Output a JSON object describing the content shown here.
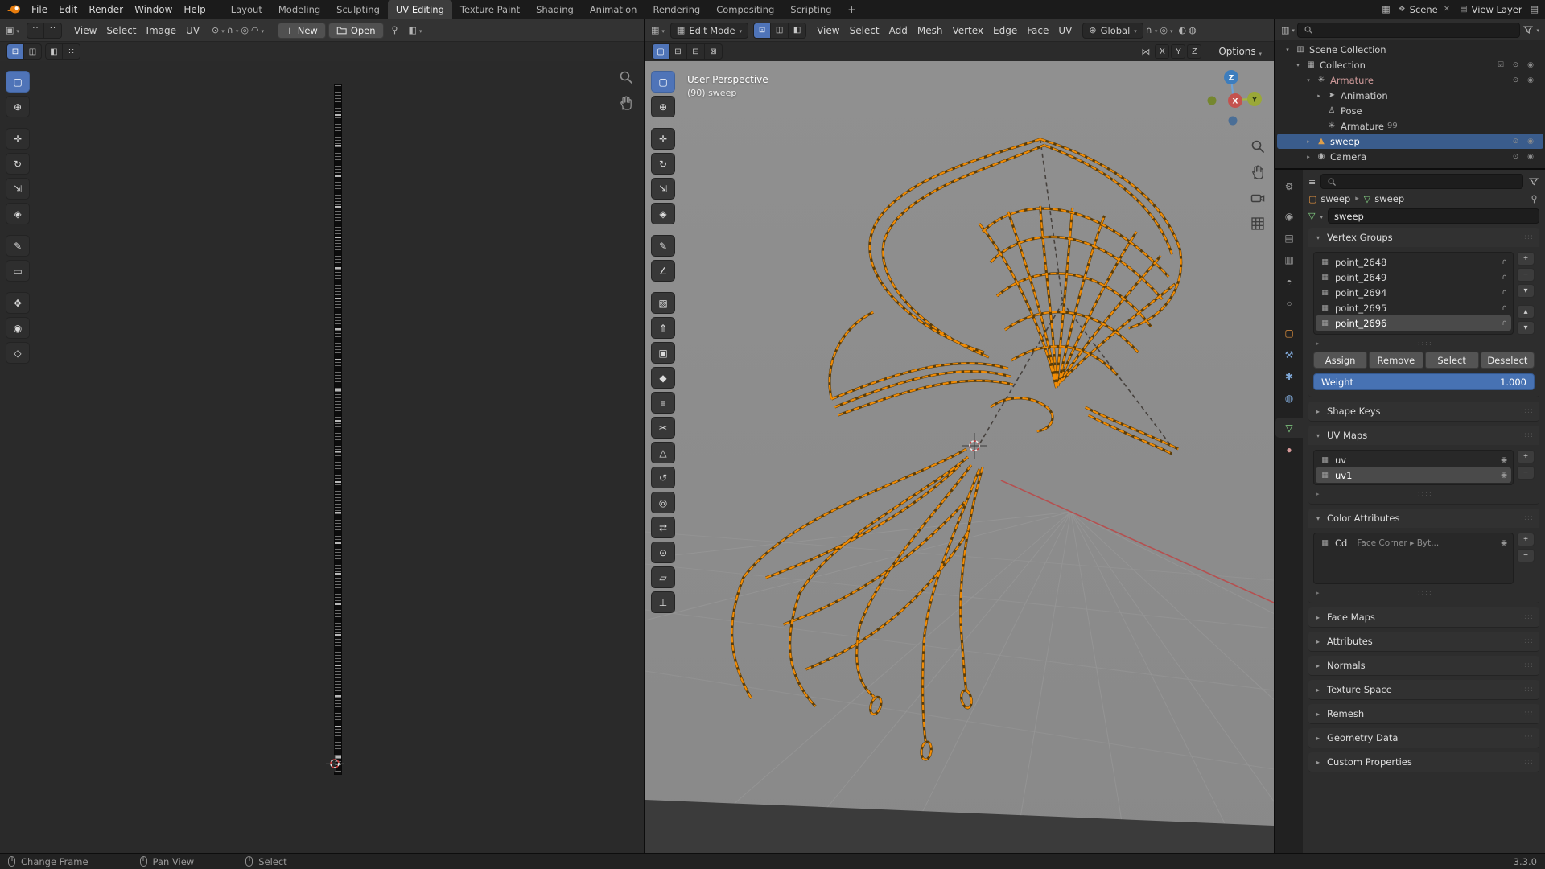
{
  "topbar": {
    "app_menus": [
      "File",
      "Edit",
      "Render",
      "Window",
      "Help"
    ],
    "workspaces": [
      {
        "name": "workspace-tab-layout",
        "label": "Layout"
      },
      {
        "name": "workspace-tab-modeling",
        "label": "Modeling"
      },
      {
        "name": "workspace-tab-sculpting",
        "label": "Sculpting"
      },
      {
        "name": "workspace-tab-uv-editing",
        "label": "UV Editing",
        "active": true
      },
      {
        "name": "workspace-tab-texture-paint",
        "label": "Texture Paint"
      },
      {
        "name": "workspace-tab-shading",
        "label": "Shading"
      },
      {
        "name": "workspace-tab-animation",
        "label": "Animation"
      },
      {
        "name": "workspace-tab-rendering",
        "label": "Rendering"
      },
      {
        "name": "workspace-tab-compositing",
        "label": "Compositing"
      },
      {
        "name": "workspace-tab-scripting",
        "label": "Scripting"
      }
    ],
    "add_workspace": "+",
    "scene_label": "Scene",
    "view_layer_label": "View Layer"
  },
  "icons": {
    "chevron": "▾",
    "expander_closed": "▸",
    "editor_image": "▣",
    "editor_3d": "▦",
    "editor_outliner": "▥",
    "editor_props": "≣",
    "grid_toggle": "∷",
    "pivot": "⊙",
    "magnet": "∩",
    "proportional": "◎",
    "falloff": "◠",
    "vertex_mode": "⊡",
    "edge_mode": "◫",
    "face_mode": "◧",
    "orientation": "⊕",
    "mirror": "⋈",
    "overlays": "◐",
    "shading": "◍",
    "plus": "+",
    "minus": "−",
    "up": "▴",
    "down": "▾",
    "scene": "❖",
    "view_layer": "▤",
    "close": "✕",
    "checkbox": "☑",
    "object": "▢",
    "mesh_data": "▽",
    "camera_toggle": "◉",
    "lock": "∩",
    "vgroup": "▦",
    "uvmap": "▦",
    "dots": "::::",
    "list_expand": "▸",
    "display_channel": "◧",
    "window_a": "▤",
    "window_b": "▦"
  },
  "uv_editor": {
    "menus": [
      "View",
      "Select",
      "Image",
      "UV"
    ],
    "new_label": "New",
    "open_label": "Open",
    "tools": [
      {
        "name": "tool-select-box",
        "icon": "▢",
        "active": true
      },
      {
        "name": "tool-cursor",
        "icon": "⊕"
      },
      {
        "name": "tool-move",
        "icon": "✛",
        "gap": true
      },
      {
        "name": "tool-rotate",
        "icon": "↻"
      },
      {
        "name": "tool-scale",
        "icon": "⇲"
      },
      {
        "name": "tool-transform",
        "icon": "◈"
      },
      {
        "name": "tool-annotate",
        "icon": "✎",
        "gap": true
      },
      {
        "name": "tool-rip-region",
        "icon": "▭"
      },
      {
        "name": "tool-grab",
        "icon": "✥",
        "gap": true
      },
      {
        "name": "tool-relax",
        "icon": "◉"
      },
      {
        "name": "tool-pinch",
        "icon": "◇"
      }
    ]
  },
  "viewport": {
    "mode_label": "Edit Mode",
    "menus": [
      "View",
      "Select",
      "Add",
      "Mesh",
      "Vertex",
      "Edge",
      "Face",
      "UV"
    ],
    "orientation_label": "Global",
    "options_label": "Options",
    "mirror_axes": [
      "X",
      "Y",
      "Z"
    ],
    "overlay": {
      "line1": "User Perspective",
      "line2": "(90) sweep"
    },
    "gizmo": {
      "x": "X",
      "y": "Y",
      "z": "Z"
    },
    "tools": [
      {
        "name": "tool-select-box",
        "icon": "▢",
        "active": true
      },
      {
        "name": "tool-cursor",
        "icon": "⊕"
      },
      {
        "name": "tool-move",
        "icon": "✛",
        "gap": true
      },
      {
        "name": "tool-rotate",
        "icon": "↻"
      },
      {
        "name": "tool-scale",
        "icon": "⇲"
      },
      {
        "name": "tool-transform",
        "icon": "◈"
      },
      {
        "name": "tool-annotate",
        "icon": "✎",
        "gap": true
      },
      {
        "name": "tool-measure",
        "icon": "∠"
      },
      {
        "name": "tool-add-cube",
        "icon": "▧",
        "gap": true
      },
      {
        "name": "tool-extrude",
        "icon": "⇑"
      },
      {
        "name": "tool-inset",
        "icon": "▣"
      },
      {
        "name": "tool-bevel",
        "icon": "◆"
      },
      {
        "name": "tool-loop-cut",
        "icon": "≡"
      },
      {
        "name": "tool-knife",
        "icon": "✂"
      },
      {
        "name": "tool-poly-build",
        "icon": "△"
      },
      {
        "name": "tool-spin",
        "icon": "↺"
      },
      {
        "name": "tool-smooth",
        "icon": "◎"
      },
      {
        "name": "tool-edge-slide",
        "icon": "⇄"
      },
      {
        "name": "tool-shrink-fatten",
        "icon": "⊙"
      },
      {
        "name": "tool-shear",
        "icon": "▱"
      },
      {
        "name": "tool-rip-region",
        "icon": "⊥"
      }
    ]
  },
  "outliner": {
    "rows": [
      {
        "name": "outliner-row-scene-collection",
        "label": "Scene Collection",
        "depth": 0,
        "expander": "▾",
        "icon": "▥",
        "right_icons": ""
      },
      {
        "name": "outliner-row-collection",
        "label": "Collection",
        "depth": 1,
        "expander": "▾",
        "icon": "▦",
        "right_icons": "☑ ⊙ ◉"
      },
      {
        "name": "outliner-row-armature",
        "label": "Armature",
        "depth": 2,
        "expander": "▾",
        "icon": "✳",
        "cls": "pink",
        "right_icons": "⊙ ◉"
      },
      {
        "name": "outliner-row-animation",
        "label": "Animation",
        "depth": 3,
        "expander": "▸",
        "icon": "➤",
        "right_icons": ""
      },
      {
        "name": "outliner-row-pose",
        "label": "Pose",
        "depth": 3,
        "expander": "",
        "icon": "♙",
        "right_icons": ""
      },
      {
        "name": "outliner-row-armature-data",
        "label": "Armature",
        "depth": 3,
        "expander": "",
        "icon": "✳",
        "badge": "99",
        "right_icons": ""
      },
      {
        "name": "outliner-row-sweep",
        "label": "sweep",
        "depth": 2,
        "expander": "▸",
        "icon": "▲",
        "cls": "meshobj",
        "selected": true,
        "right_icons": "⊙ ◉"
      },
      {
        "name": "outliner-row-camera",
        "label": "Camera",
        "depth": 2,
        "expander": "▸",
        "icon": "◉",
        "right_icons": "⊙ ◉"
      }
    ]
  },
  "properties": {
    "tabs": [
      {
        "name": "properties-tab-tool",
        "icon": "⚙"
      },
      {
        "name": "properties-tab-render",
        "icon": "◉",
        "gap": true
      },
      {
        "name": "properties-tab-output",
        "icon": "▤"
      },
      {
        "name": "properties-tab-view-layer",
        "icon": "▥"
      },
      {
        "name": "properties-tab-scene",
        "icon": "◓"
      },
      {
        "name": "properties-tab-world",
        "icon": "○"
      },
      {
        "name": "properties-tab-object",
        "icon": "▢",
        "cls": "tint-orange",
        "gap": true
      },
      {
        "name": "properties-tab-modifiers",
        "icon": "⚒",
        "cls": "tint-blue"
      },
      {
        "name": "properties-tab-particles",
        "icon": "✱",
        "cls": "tint-blue"
      },
      {
        "name": "properties-tab-physics",
        "icon": "◍",
        "cls": "tint-blue"
      },
      {
        "name": "properties-tab-object-data",
        "icon": "▽",
        "cls": "tint-green",
        "active": true,
        "gap": true
      },
      {
        "name": "properties-tab-material",
        "icon": "●",
        "cls": "tint-pink"
      }
    ],
    "breadcrumb": {
      "object": "sweep",
      "data": "sweep"
    },
    "name_value": "sweep",
    "vertex_groups": {
      "title": "Vertex Groups",
      "rows": [
        {
          "label": "point_2648"
        },
        {
          "label": "point_2649"
        },
        {
          "label": "point_2694"
        },
        {
          "label": "point_2695"
        },
        {
          "label": "point_2696",
          "active": true
        }
      ],
      "assign": "Assign",
      "remove": "Remove",
      "select": "Select",
      "deselect": "Deselect",
      "weight_label": "Weight",
      "weight_value": "1.000"
    },
    "shape_keys_title": "Shape Keys",
    "uv_maps": {
      "title": "UV Maps",
      "rows": [
        {
          "label": "uv"
        },
        {
          "label": "uv1",
          "active": true
        }
      ]
    },
    "color_attributes": {
      "title": "Color Attributes",
      "rows": [
        {
          "label": "Cd",
          "type": "Face Corner ▸ Byt..."
        }
      ]
    },
    "collapsed_panels": [
      {
        "name": "panel-face-maps",
        "label": "Face Maps"
      },
      {
        "name": "panel-attributes",
        "label": "Attributes"
      },
      {
        "name": "panel-normals",
        "label": "Normals"
      },
      {
        "name": "panel-texture-space",
        "label": "Texture Space"
      },
      {
        "name": "panel-remesh",
        "label": "Remesh"
      },
      {
        "name": "panel-geometry-data",
        "label": "Geometry Data"
      },
      {
        "name": "panel-custom-properties",
        "label": "Custom Properties"
      }
    ]
  },
  "statusbar": {
    "hints": [
      {
        "name": "status-hint-change-frame",
        "label": "Change Frame"
      },
      {
        "name": "status-hint-pan-view",
        "label": "Pan View"
      },
      {
        "name": "status-hint-select",
        "label": "Select"
      }
    ],
    "version": "3.3.0"
  }
}
